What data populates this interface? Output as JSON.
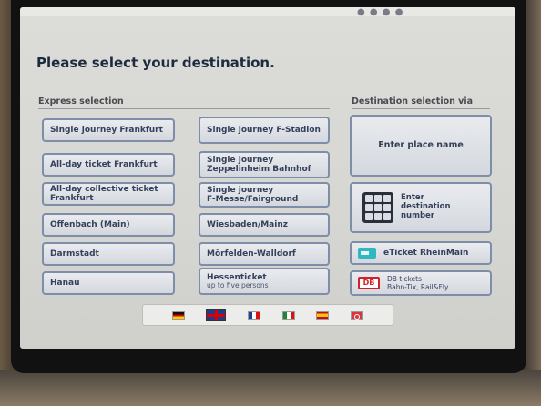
{
  "screen": {
    "title": "Please select your destination.",
    "express_label": "Express selection",
    "destination_label": "Destination selection via"
  },
  "express": {
    "single_journey_frankfurt": "Single journey Frankfurt",
    "all_day_ticket_frankfurt": "All-day ticket Frankfurt",
    "all_day_collective_line1": "All-day collective ticket",
    "all_day_collective_line2": "Frankfurt",
    "offenbach": "Offenbach (Main)",
    "darmstadt": "Darmstadt",
    "hanau": "Hanau",
    "single_journey_fstadion": "Single journey F-Stadion",
    "single_journey_zepp_line1": "Single journey",
    "single_journey_zepp_line2": "Zeppelinheim Bahnhof",
    "single_journey_messe_line1": "Single journey",
    "single_journey_messe_line2": "F-Messe/Fairground",
    "wiesbaden_mainz": "Wiesbaden/Mainz",
    "morfelden": "Mörfelden-Walldorf",
    "hessenticket": "Hessenticket",
    "hessenticket_sub": "up to five persons"
  },
  "destination": {
    "enter_place_name": "Enter place name",
    "enter_number_line1": "Enter",
    "enter_number_line2": "destination",
    "enter_number_line3": "number",
    "eticket": "eTicket RheinMain",
    "db_logo": "DB",
    "db_line1": "DB tickets",
    "db_line2": "Bahn-Tix, Rail&Fly"
  },
  "languages": [
    "German",
    "English",
    "French",
    "Italian",
    "Spanish",
    "Turkish"
  ],
  "colors": {
    "button_border": "#7f8ea8",
    "button_text": "#35415a",
    "db_red": "#d0222a",
    "eticket_teal": "#30b8c0"
  }
}
